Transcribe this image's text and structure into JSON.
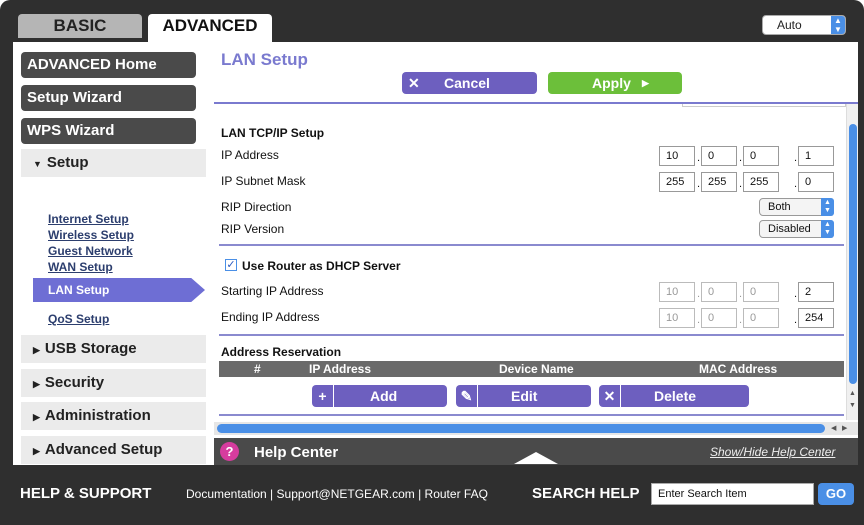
{
  "tabs": {
    "basic": "BASIC",
    "advanced": "ADVANCED"
  },
  "language": {
    "selected": "Auto"
  },
  "sidebar": {
    "advanced_home": "ADVANCED Home",
    "setup_wizard": "Setup Wizard",
    "wps_wizard": "WPS Wizard",
    "setup": "Setup",
    "sub_items": [
      "Internet Setup",
      "Wireless Setup",
      "Guest Network",
      "WAN Setup",
      "LAN Setup",
      "QoS Setup"
    ],
    "usb_storage": "USB Storage",
    "security": "Security",
    "administration": "Administration",
    "advanced_setup": "Advanced Setup"
  },
  "main": {
    "title": "LAN Setup",
    "cancel_label": "Cancel",
    "apply_label": "Apply"
  },
  "lan": {
    "section_title": "LAN TCP/IP Setup",
    "ip_address_label": "IP Address",
    "ip_address": [
      "10",
      "0",
      "0",
      "1"
    ],
    "subnet_label": "IP Subnet Mask",
    "subnet": [
      "255",
      "255",
      "255",
      "0"
    ],
    "rip_direction_label": "RIP Direction",
    "rip_direction": "Both",
    "rip_version_label": "RIP Version",
    "rip_version": "Disabled"
  },
  "dhcp": {
    "checkbox_label": "Use Router as DHCP Server",
    "checked": true,
    "start_label": "Starting IP Address",
    "start_ip": [
      "10",
      "0",
      "0",
      "2"
    ],
    "end_label": "Ending IP Address",
    "end_ip": [
      "10",
      "0",
      "0",
      "254"
    ]
  },
  "reservation": {
    "title": "Address Reservation",
    "columns": [
      "#",
      "IP Address",
      "Device Name",
      "MAC Address"
    ],
    "add_label": "Add",
    "edit_label": "Edit",
    "delete_label": "Delete"
  },
  "help": {
    "center_label": "Help Center",
    "toggle_label": "Show/Hide Help Center"
  },
  "footer": {
    "help_support": "HELP & SUPPORT",
    "documentation": "Documentation",
    "support_email": "Support@NETGEAR.com",
    "router_faq": "Router FAQ",
    "search_help": "SEARCH HELP",
    "search_placeholder": "Enter Search Item",
    "go_label": "GO"
  },
  "colors": {
    "accent_purple": "#6d5fbf",
    "apply_green": "#6cbf3a",
    "nav_dark": "#4a4a4a",
    "scroll_blue": "#4a8fe6"
  }
}
